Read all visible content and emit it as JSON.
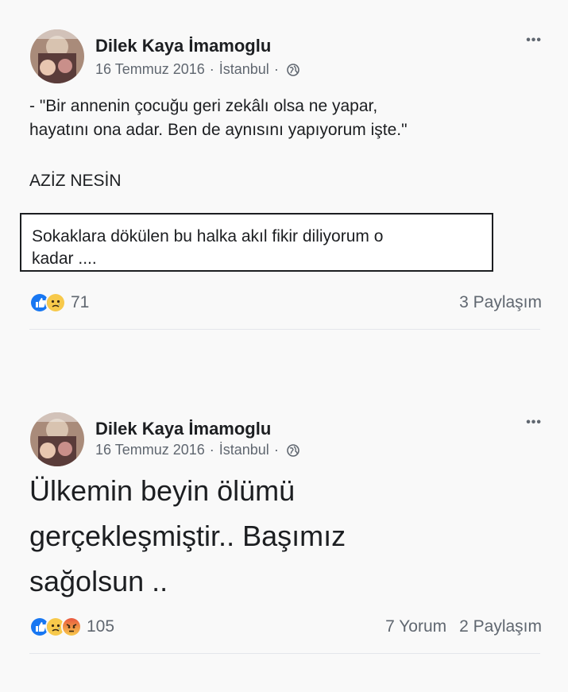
{
  "posts": [
    {
      "author": "Dilek Kaya İmamoglu",
      "date": "16 Temmuz 2016",
      "separator": "·",
      "location": "İstanbul",
      "privacy_icon": "globe-icon",
      "more_icon": "•••",
      "text_lines": [
        "- \"Bir annenin çocuğu geri zekâlı olsa ne yapar,",
        "hayatını ona adar. Ben de aynısını yapıyorum işte.\""
      ],
      "quote_author": "AZİZ NESİN",
      "boxed_lines": [
        "Sokaklara dökülen bu halka akıl fikir diliyorum o",
        "kadar ...."
      ],
      "reactions": [
        "like",
        "sad"
      ],
      "reaction_count": "71",
      "shares": "3 Paylaşım"
    },
    {
      "author": "Dilek Kaya İmamoglu",
      "date": "16 Temmuz 2016",
      "separator": "·",
      "location": "İstanbul",
      "privacy_icon": "globe-icon",
      "more_icon": "•••",
      "big_lines": [
        "Ülkemin beyin ölümü",
        "gerçekleşmiştir.. Başımız",
        "sağolsun .."
      ],
      "reactions": [
        "like",
        "sad",
        "angry"
      ],
      "reaction_count": "105",
      "comments": "7 Yorum",
      "shares": "2 Paylaşım"
    }
  ],
  "colors": {
    "like_blue": "#1877f2",
    "sad_yellow": "#f7c94b",
    "angry_red": "#e9573f",
    "meta_gray": "#606770",
    "text_dark": "#1c1e21"
  }
}
